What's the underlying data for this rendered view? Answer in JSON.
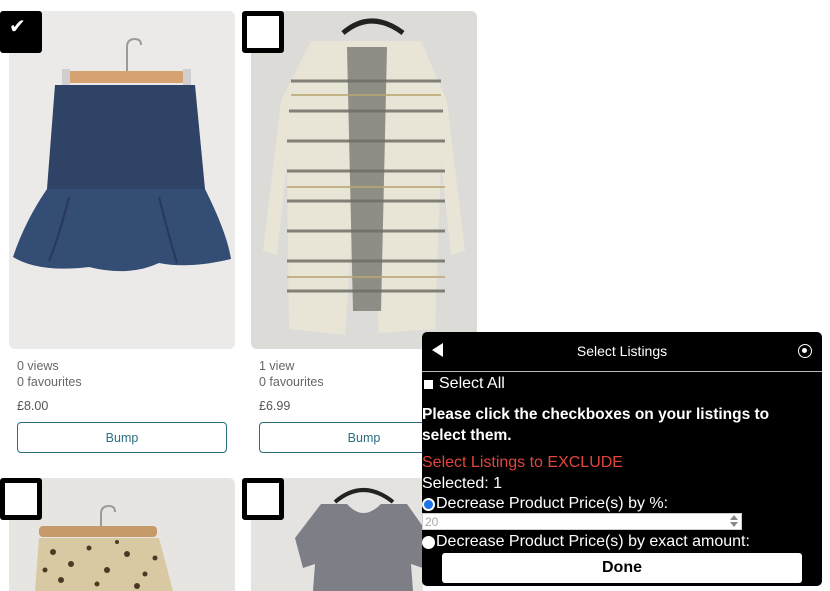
{
  "listings": [
    {
      "views": "0 views",
      "favourites": "0 favourites",
      "price": "£8.00",
      "bump_label": "Bump",
      "checked": true,
      "item": "skirt"
    },
    {
      "views": "1 view",
      "favourites": "0 favourites",
      "price": "£6.99",
      "bump_label": "Bump",
      "checked": false,
      "item": "cardigan"
    },
    {
      "checked": false,
      "item": "leopard-print-skirt"
    },
    {
      "checked": false,
      "item": "grey-top"
    }
  ],
  "panel": {
    "title": "Select Listings",
    "select_all_label": "Select All",
    "instructions": "Please click the checkboxes on your listings to select them.",
    "exclude_label": "Select Listings to EXCLUDE",
    "selected_count": "Selected: 1",
    "option_percent_label": "Decrease Product Price(s) by %:",
    "percent_value": "20",
    "option_amount_label": "Decrease Product Price(s) by exact amount:",
    "done_label": "Done"
  },
  "colors": {
    "bump_border": "#2a6f7e",
    "exclude_text": "#e0453c",
    "panel_bg": "#000000",
    "radio_selected": "#1a73e8"
  },
  "icons": {
    "check": "check-icon",
    "back": "back-arrow-icon",
    "close": "close-circle-icon"
  }
}
